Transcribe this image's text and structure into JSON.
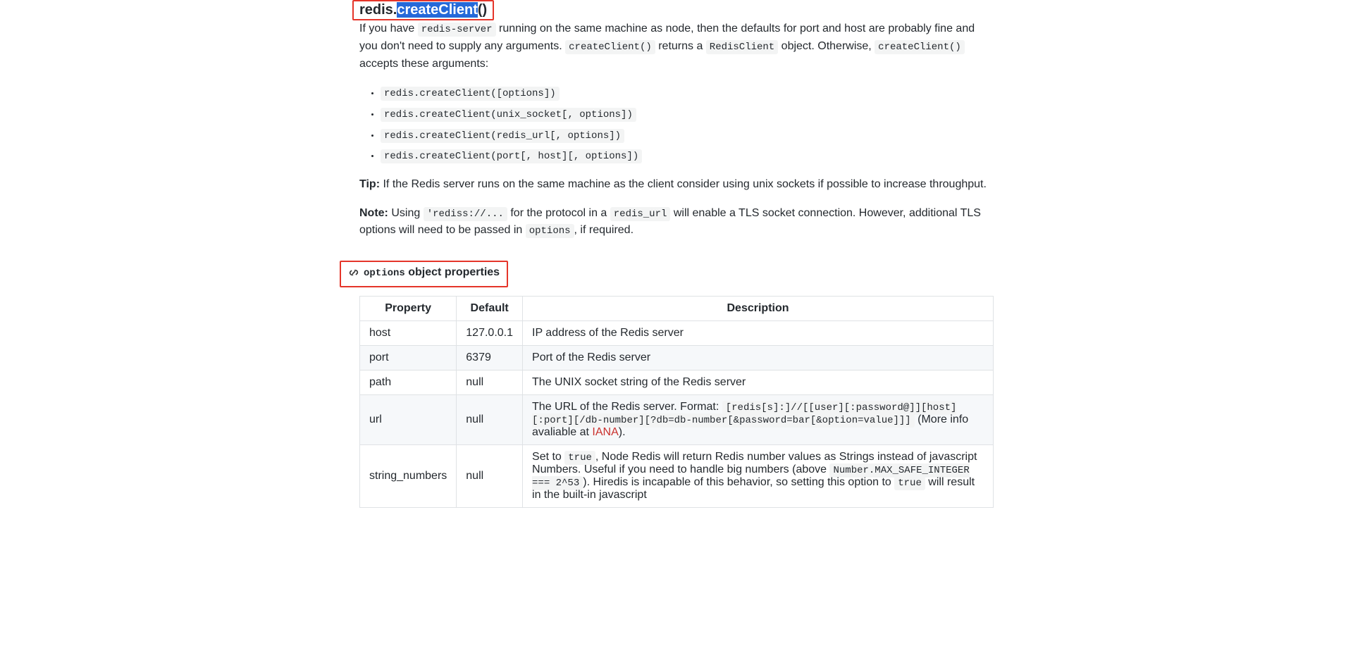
{
  "heading": {
    "redis_prefix": "redis.",
    "createClient_sel": "createClient",
    "paren": "()"
  },
  "intro": {
    "before1": "If you have ",
    "code1": "redis-server",
    "after1": " running on the same machine as node, then the defaults for port and host are probably fine and you don't need to supply any arguments. ",
    "code2": "createClient()",
    "after2": " returns a ",
    "code3": "RedisClient",
    "after3": " object. Otherwise, ",
    "code4": "createClient()",
    "after4": " accepts these arguments:"
  },
  "overloads": [
    "redis.createClient([options])",
    "redis.createClient(unix_socket[, options])",
    "redis.createClient(redis_url[, options])",
    "redis.createClient(port[, host][, options])"
  ],
  "tip": {
    "label": "Tip:",
    "text": " If the Redis server runs on the same machine as the client consider using unix sockets if possible to increase throughput."
  },
  "note": {
    "label": "Note:",
    "before1": " Using ",
    "code1": "'rediss://...",
    "mid1": " for the protocol in a ",
    "code2": "redis_url",
    "mid2": " will enable a TLS socket connection. However, additional TLS options will need to be passed in ",
    "code3": "options",
    "after": ", if required."
  },
  "options_heading": {
    "code": "options",
    "text": " object properties"
  },
  "table": {
    "headers": {
      "property": "Property",
      "default": "Default",
      "description": "Description"
    },
    "rows": {
      "host": {
        "prop": "host",
        "def": "127.0.0.1",
        "desc": "IP address of the Redis server"
      },
      "port": {
        "prop": "port",
        "def": "6379",
        "desc": "Port of the Redis server"
      },
      "path": {
        "prop": "path",
        "def": "null",
        "desc": "The UNIX socket string of the Redis server"
      },
      "url": {
        "prop": "url",
        "def": "null",
        "pre": "The URL of the Redis server. Format: ",
        "code": "[redis[s]:]//[[user][:password@]][host][:port][/db-number][?db=db-number[&password=bar[&option=value]]]",
        "post1": " (More info avaliable at ",
        "link": "IANA",
        "post2": ")."
      },
      "string_numbers": {
        "prop": "string_numbers",
        "def": "null",
        "t1": "Set to ",
        "c1": "true",
        "t2": ", Node Redis will return Redis number values as Strings instead of javascript Numbers. Useful if you need to handle big numbers (above ",
        "c2": "Number.MAX_SAFE_INTEGER === 2^53",
        "t3": "). Hiredis is incapable of this behavior, so setting this option to ",
        "c3": "true",
        "t4": " will result in the built-in javascript"
      }
    }
  }
}
